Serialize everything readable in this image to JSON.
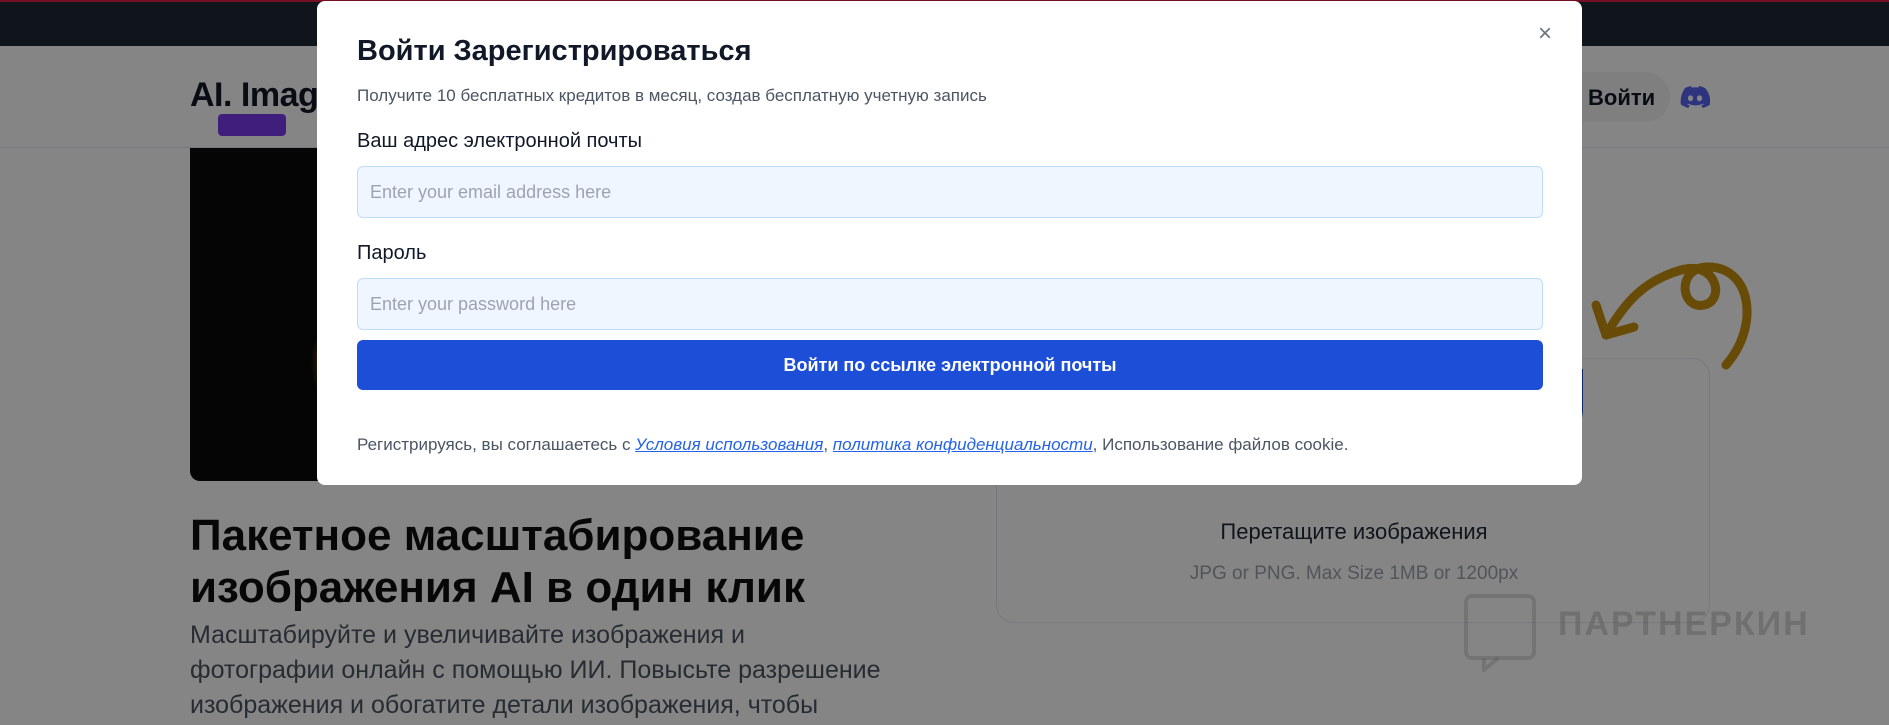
{
  "header": {
    "logo": "AI. Image",
    "login_label": "Войти"
  },
  "hero": {
    "title_line1": "Пакетное масштабирование",
    "title_line2": "изображения AI в один клик",
    "description": "Масштабируйте и увеличивайте изображения и фотографии онлайн с помощью ИИ. Повысьте разрешение изображения и обогатите детали изображения, чтобы показать потрясающие"
  },
  "upload": {
    "drag_label": "Перетащите изображения",
    "size_hint": "JPG or PNG. Max Size 1MB or 1200px"
  },
  "watermark": {
    "text": "ПАРТНЕРКИН"
  },
  "modal": {
    "title_login": "Войти",
    "title_register": "Зарегистрироваться",
    "subtitle": "Получите 10 бесплатных кредитов в месяц, создав бесплатную учетную запись",
    "email_label": "Ваш адрес электронной почты",
    "email_placeholder": "Enter your email address here",
    "password_label": "Пароль",
    "password_placeholder": "Enter your password here",
    "submit_label": "Войти по ссылке электронной почты",
    "terms_prefix": "Регистрируясь, вы соглашаетесь с ",
    "terms_link": "Условия использования",
    "terms_sep": ", ",
    "privacy_link": "политика конфиденциальности",
    "terms_suffix": ", Использование файлов cookie.",
    "close_glyph": "×"
  },
  "colors": {
    "primary": "#1d4ed8",
    "input_bg": "#eff6ff",
    "topbar": "#1f2937",
    "accent_arrow": "#c8900e"
  }
}
